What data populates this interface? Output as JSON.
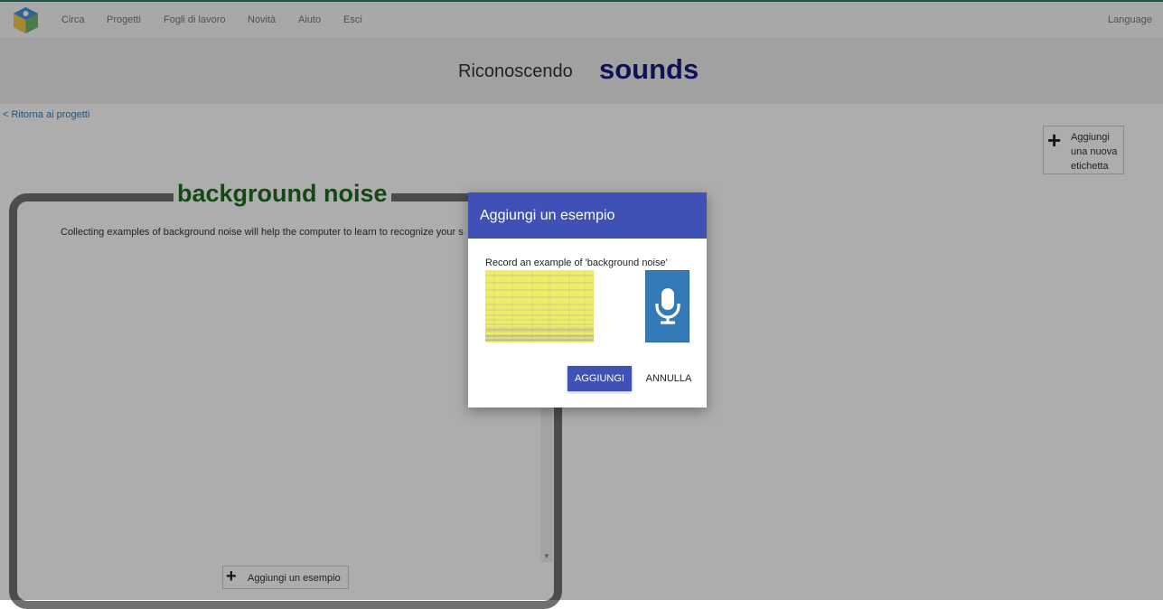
{
  "nav": {
    "items": [
      "Circa",
      "Progetti",
      "Fogli di lavoro",
      "Novità",
      "Aiuto",
      "Esci"
    ],
    "language": "Language"
  },
  "header": {
    "prefix": "Riconoscendo",
    "project": "sounds"
  },
  "back_link": "< Ritorna ai progetti",
  "add_label_button": "Aggiungi una nuova etichetta",
  "label_card": {
    "title": "background noise",
    "description": "Collecting examples of background noise will help the computer to learn to recognize your s",
    "add_example_button": "Aggiungi un esempio"
  },
  "dialog": {
    "title": "Aggiungi un esempio",
    "prompt": "Record an example of 'background noise'",
    "add_button": "AGGIUNGI",
    "cancel_button": "ANNULLA"
  },
  "colors": {
    "dialog_header": "#3f51b5",
    "project_title": "#1a1a80",
    "label_title": "#1e6b1e",
    "mic_button": "#337ab7"
  },
  "icons": [
    "logo-icon",
    "plus-icon",
    "microphone-icon",
    "scroll-down-arrow-icon"
  ]
}
